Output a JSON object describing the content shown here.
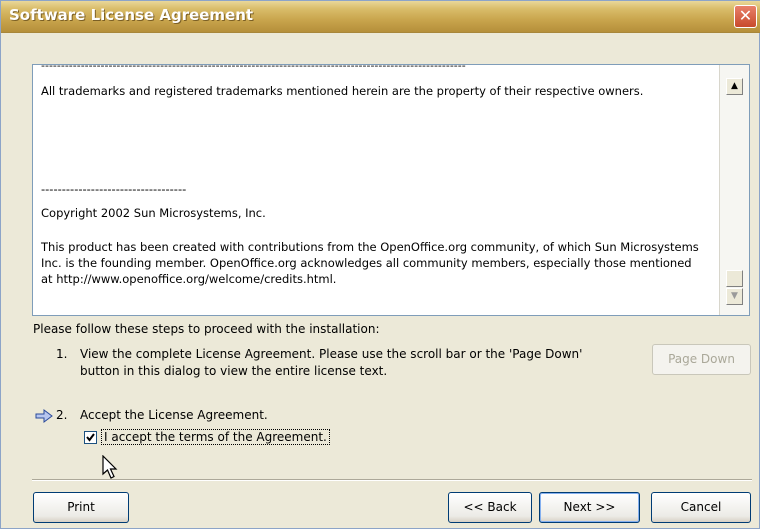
{
  "window": {
    "title": "Software License Agreement",
    "close_glyph": "✕"
  },
  "license_text": {
    "dashes_top": "-----------------------------------------------------------------------------------------------------------",
    "paragraph1": "All trademarks and registered trademarks mentioned herein are the property of their respective owners.",
    "dashes2": "-----------------------------------",
    "copyright": "Copyright 2002 Sun Microsystems, Inc.",
    "paragraph3": "This product has been created with contributions from the OpenOffice.org community, of which Sun Microsystems Inc. is the founding member. OpenOffice.org acknowledges all community members, especially those mentioned at http://www.openoffice.org/welcome/credits.html."
  },
  "scrollbar": {
    "up_glyph": "▲",
    "down_glyph": "▼"
  },
  "steps": {
    "intro": "Please follow these steps to proceed with the installation:",
    "step1_num": "1.",
    "step1_text": "View the complete License Agreement. Please use the scroll bar or the 'Page Down' button in this dialog to view the entire license text.",
    "step2_num": "2.",
    "step2_text": "Accept the License Agreement.",
    "current_step_icon": "right-arrow-icon"
  },
  "checkbox": {
    "checked": true,
    "label": "I accept the terms of the Agreement."
  },
  "buttons": {
    "page_down": "Page Down",
    "print": "Print",
    "back": "<< Back",
    "next": "Next >>",
    "cancel": "Cancel"
  },
  "colors": {
    "titlebar": "#c9a54d",
    "dialog_bg": "#ece9d8",
    "close_button": "#d85a3c"
  }
}
